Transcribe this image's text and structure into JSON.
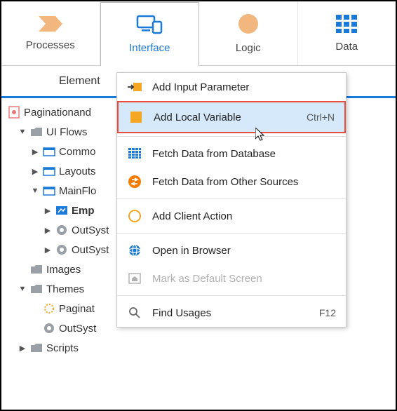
{
  "tabs": {
    "processes": "Processes",
    "interface": "Interface",
    "logic": "Logic",
    "data": "Data"
  },
  "subtabs": {
    "elements": "Element"
  },
  "tree": {
    "root": "Paginationand",
    "ui_flows": "UI Flows",
    "common": "Commo",
    "layouts": "Layouts",
    "mainflow": "MainFlo",
    "emp": "Emp",
    "outsyst1": "OutSyst",
    "outsyst2": "OutSyst",
    "images": "Images",
    "themes": "Themes",
    "paginat": "Paginat",
    "outsyst3": "OutSyst",
    "scripts": "Scripts"
  },
  "menu": {
    "add_input": "Add Input Parameter",
    "add_local": "Add Local Variable",
    "add_local_shortcut": "Ctrl+N",
    "fetch_db": "Fetch Data from Database",
    "fetch_other": "Fetch Data from Other Sources",
    "add_client": "Add Client Action",
    "open_browser": "Open in Browser",
    "mark_default": "Mark as Default Screen",
    "find_usages": "Find Usages",
    "find_usages_shortcut": "F12"
  },
  "colors": {
    "accent": "#1a7ad9",
    "tan": "#f2b77e",
    "orange": "#f5a623",
    "highlight_border": "#e74c3c"
  }
}
